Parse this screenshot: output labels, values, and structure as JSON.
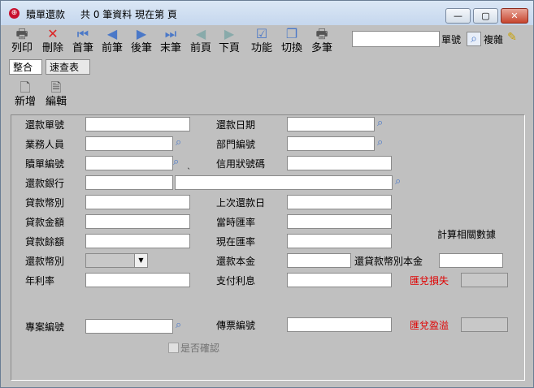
{
  "window": {
    "title": "贖單還款",
    "status": "共 0 筆資料  現在第 頁",
    "min_glyph": "—",
    "max_glyph": "▢",
    "close_glyph": "✕"
  },
  "toolbar": {
    "buttons": [
      {
        "label": "列印",
        "icon": "printer-icon",
        "glyph": "🖶"
      },
      {
        "label": "刪除",
        "icon": "delete-icon",
        "glyph": "✕"
      },
      {
        "label": "首筆",
        "icon": "first-icon",
        "glyph": "⏮"
      },
      {
        "label": "前筆",
        "icon": "prev-icon",
        "glyph": "◀"
      },
      {
        "label": "後筆",
        "icon": "next-icon",
        "glyph": "▶"
      },
      {
        "label": "末筆",
        "icon": "last-icon",
        "glyph": "⏭"
      },
      {
        "label": "前頁",
        "icon": "prev-page-icon",
        "glyph": "◀"
      },
      {
        "label": "下頁",
        "icon": "next-page-icon",
        "glyph": "▶"
      },
      {
        "label": "功能",
        "icon": "function-icon",
        "glyph": "☑"
      },
      {
        "label": "切換",
        "icon": "switch-icon",
        "glyph": "❐"
      },
      {
        "label": "多筆",
        "icon": "multi-icon",
        "glyph": "🖶"
      }
    ],
    "search_value": "",
    "doc_no_label": "單號",
    "copy_label": "複雜"
  },
  "tabs": [
    "整合",
    "速查表"
  ],
  "sub_toolbar": [
    {
      "label": "新增",
      "icon": "new-document-icon",
      "glyph": "🗋"
    },
    {
      "label": "編輯",
      "icon": "edit-document-icon",
      "glyph": "🗎"
    }
  ],
  "form": {
    "repay_no": "還款單號",
    "repay_date": "還款日期",
    "salesperson": "業務人員",
    "dept_no": "部門編號",
    "redeem_no": "贖單編號",
    "lc_no": "信用狀號碼",
    "repay_bank": "還款銀行",
    "loan_currency": "貸款幣別",
    "last_repay_date": "上次還款日",
    "loan_amount": "貸款金額",
    "rate_then": "當時匯率",
    "loan_balance": "貸款餘額",
    "rate_now": "現在匯率",
    "calc_related": "計算相關數據",
    "repay_currency": "還款幣別",
    "repay_principal": "還款本金",
    "repay_loan_principal": "還貸款幣別本金",
    "annual_rate": "年利率",
    "interest_paid": "支付利息",
    "fx_loss": "匯兌損失",
    "project_no": "專案編號",
    "voucher_no": "傳票編號",
    "fx_gain": "匯兌盈溢",
    "confirmed": "是否確認",
    "small_mark": "ˎ"
  },
  "colors": {
    "window_bg": "#c0c0c0",
    "accent_red": "#e00000",
    "icon_blue": "#4a78c8"
  }
}
